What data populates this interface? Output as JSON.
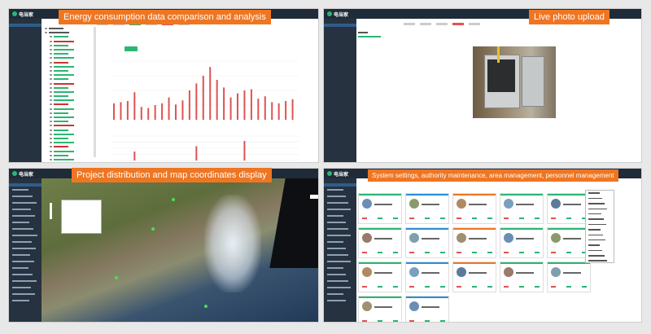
{
  "captions": {
    "energy": "Energy consumption data comparison and analysis",
    "photo": "Live photo upload",
    "map": "Project distribution and map coordinates display",
    "settings": "System settings, authority maintenance, area management, personnel management"
  },
  "app": {
    "logo": "电当家"
  },
  "colors": {
    "accent_orange": "#ee7623",
    "brand_green": "#2bb673",
    "nav_dark": "#1f2b38",
    "bar_red": "#e05252"
  },
  "chart_data": [
    {
      "type": "bar",
      "title": "",
      "series": [
        {
          "name": "",
          "values": [
            28,
            30,
            32,
            47,
            22,
            20,
            25,
            28,
            38,
            26,
            33,
            50,
            62,
            75,
            90,
            68,
            55,
            38,
            45,
            50,
            52,
            36,
            40,
            30,
            28,
            32,
            35
          ]
        }
      ],
      "ylim": [
        0,
        100
      ],
      "grid": true
    },
    {
      "type": "bar",
      "title": "",
      "series": [
        {
          "name": "",
          "values": [
            0,
            0,
            0,
            22,
            0,
            0,
            0,
            0,
            0,
            0,
            0,
            0,
            35,
            0,
            0,
            0,
            0,
            0,
            0,
            48,
            0,
            0,
            0,
            0,
            0,
            0,
            0
          ]
        }
      ],
      "ylim": [
        0,
        60
      ],
      "grid": true
    }
  ]
}
